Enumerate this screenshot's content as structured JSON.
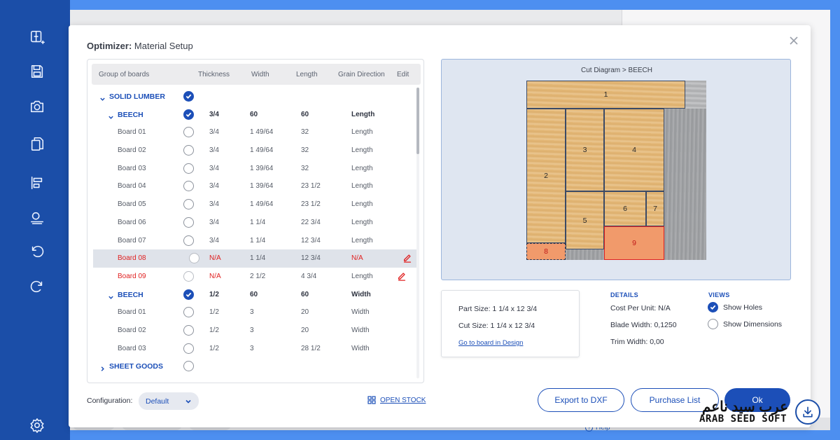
{
  "dialog": {
    "title_prefix": "Optimizer:",
    "title": "Material Setup"
  },
  "table": {
    "headers": [
      "Group of boards",
      "Thickness",
      "Width",
      "Length",
      "Grain Direction",
      "Edit"
    ],
    "rows": [
      {
        "type": "group",
        "name": "SOLID LUMBER",
        "checked": true,
        "thickness": "",
        "width": "",
        "length": "",
        "grain": ""
      },
      {
        "type": "subgroup",
        "name": "BEECH",
        "checked": true,
        "thickness": "3/4",
        "width": "60",
        "length": "60",
        "grain": "Length"
      },
      {
        "type": "item",
        "name": "Board 01",
        "thickness": "3/4",
        "width": "1 49/64",
        "length": "32",
        "grain": "Length"
      },
      {
        "type": "item",
        "name": "Board 02",
        "thickness": "3/4",
        "width": "1 49/64",
        "length": "32",
        "grain": "Length"
      },
      {
        "type": "item",
        "name": "Board 03",
        "thickness": "3/4",
        "width": "1 39/64",
        "length": "32",
        "grain": "Length"
      },
      {
        "type": "item",
        "name": "Board 04",
        "thickness": "3/4",
        "width": "1 39/64",
        "length": "23 1/2",
        "grain": "Length"
      },
      {
        "type": "item",
        "name": "Board 05",
        "thickness": "3/4",
        "width": "1 49/64",
        "length": "23 1/2",
        "grain": "Length"
      },
      {
        "type": "item",
        "name": "Board 06",
        "thickness": "3/4",
        "width": "1 1/4",
        "length": "22 3/4",
        "grain": "Length"
      },
      {
        "type": "item",
        "name": "Board 07",
        "thickness": "3/4",
        "width": "1 1/4",
        "length": "12 3/4",
        "grain": "Length"
      },
      {
        "type": "item",
        "name": "Board 08",
        "thickness": "N/A",
        "width": "1 1/4",
        "length": "12 3/4",
        "grain": "N/A",
        "error": true,
        "selected": true,
        "editable": true
      },
      {
        "type": "item",
        "name": "Board 09",
        "thickness": "N/A",
        "width": "2 1/2",
        "length": "4 3/4",
        "grain": "Length",
        "error": true,
        "editable": true
      },
      {
        "type": "subgroup",
        "name": "BEECH",
        "checked": true,
        "thickness": "1/2",
        "width": "60",
        "length": "60",
        "grain": "Width"
      },
      {
        "type": "item",
        "name": "Board 01",
        "thickness": "1/2",
        "width": "3",
        "length": "20",
        "grain": "Width"
      },
      {
        "type": "item",
        "name": "Board 02",
        "thickness": "1/2",
        "width": "3",
        "length": "20",
        "grain": "Width"
      },
      {
        "type": "item",
        "name": "Board 03",
        "thickness": "1/2",
        "width": "3",
        "length": "28 1/2",
        "grain": "Width"
      },
      {
        "type": "group-collapsed",
        "name": "SHEET GOODS",
        "checked": false,
        "thickness": "",
        "width": "",
        "length": "",
        "grain": ""
      }
    ]
  },
  "configuration": {
    "label": "Configuration:",
    "value": "Default",
    "open_stock_label": "OPEN STOCK"
  },
  "diagram": {
    "title": "Cut Diagram  > BEECH",
    "parts": [
      {
        "label": "1",
        "state": "normal"
      },
      {
        "label": "2",
        "state": "normal"
      },
      {
        "label": "3",
        "state": "normal"
      },
      {
        "label": "4",
        "state": "normal"
      },
      {
        "label": "5",
        "state": "normal"
      },
      {
        "label": "6",
        "state": "normal"
      },
      {
        "label": "7",
        "state": "normal"
      },
      {
        "label": "8",
        "state": "selected"
      },
      {
        "label": "9",
        "state": "highlight"
      }
    ]
  },
  "part_info": {
    "part_size": "Part Size:  1 1/4 x 12 3/4",
    "cut_size": "Cut Size:  1 1/4 x 12 3/4",
    "link": "Go to board in Design"
  },
  "details": {
    "heading": "DETAILS",
    "cost": "Cost Per Unit: N/A",
    "blade": "Blade Width: 0,1250",
    "trim": "Trim Width: 0,00"
  },
  "views": {
    "heading": "VIEWS",
    "show_holes": "Show Holes",
    "show_holes_checked": true,
    "show_dimensions": "Show Dimensions",
    "show_dimensions_checked": false
  },
  "buttons": {
    "export": "Export to DXF",
    "purchase": "Purchase List",
    "ok": "Ok"
  },
  "background": {
    "help": "Help"
  },
  "watermark": {
    "arabic": "عرب سيد ناعم",
    "latin": "ARAB SEED SOFT"
  },
  "colors": {
    "accent": "#1c4fb8",
    "error": "#e02121",
    "toolbar": "#1b4ea8",
    "frame": "#4d8ff0"
  }
}
